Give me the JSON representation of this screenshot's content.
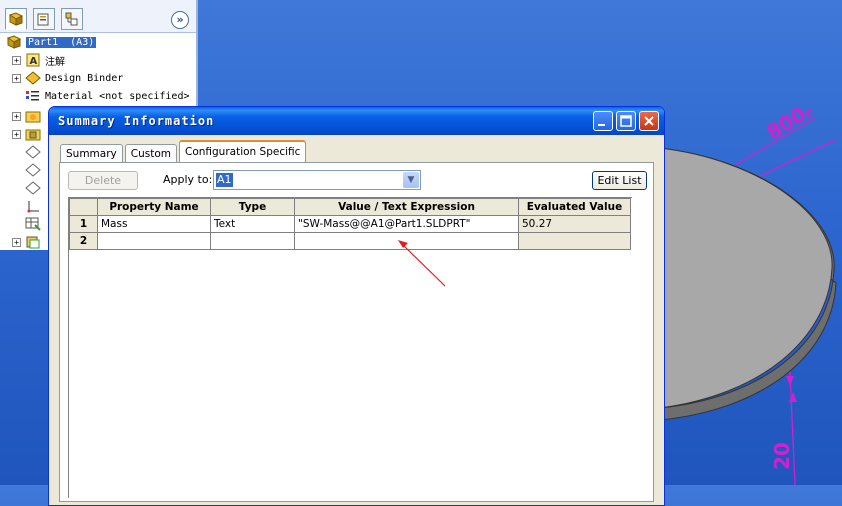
{
  "tree": {
    "root": {
      "name": "Part1",
      "config": "(A3)"
    },
    "items": [
      {
        "label": "注解",
        "icon": "annotations-icon",
        "toggle": "+"
      },
      {
        "label": "Design Binder",
        "icon": "design-binder-icon",
        "toggle": "+"
      },
      {
        "label": "Material <not specified>",
        "icon": "material-icon",
        "toggle": ""
      }
    ],
    "expand_glyph": "»"
  },
  "dialog": {
    "title": "Summary Information",
    "tabs": [
      {
        "label": "Summary",
        "active": false
      },
      {
        "label": "Custom",
        "active": false
      },
      {
        "label": "Configuration Specific",
        "active": true
      }
    ],
    "delete_label": "Delete",
    "apply_label": "Apply to:",
    "apply_value": "A1",
    "edit_list_label": "Edit List",
    "columns": [
      "",
      "Property Name",
      "Type",
      "Value / Text Expression",
      "Evaluated Value"
    ],
    "rows": [
      {
        "num": "1",
        "name": "Mass",
        "type": "Text",
        "value": "\"SW-Mass@@A1@Part1.SLDPRT\"",
        "evaluated": "50.27"
      },
      {
        "num": "2",
        "name": "",
        "type": "",
        "value": "",
        "evaluated": ""
      }
    ]
  },
  "dimensions": {
    "diameter": "800",
    "thickness": "20"
  },
  "colors": {
    "title_bar": "#0a5fe6",
    "selection": "#316ac5",
    "dimension": "#d020d0",
    "arrow": "#e02020"
  }
}
